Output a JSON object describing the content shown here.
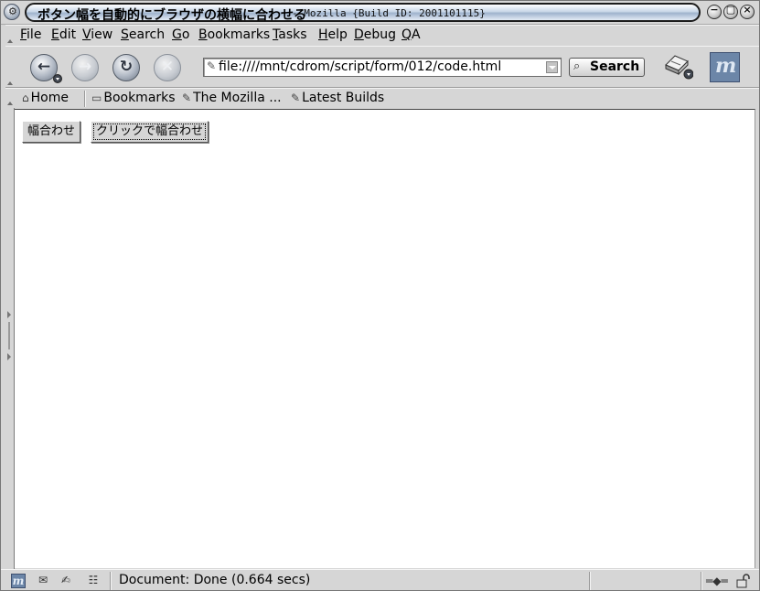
{
  "window": {
    "title": "ボタン幅を自動的にブラウザの横幅に合わせる",
    "app_title": "- Mozilla {Build ID: 2001101115}",
    "menu_glyph": "⚙",
    "minimize_glyph": "−",
    "maximize_glyph": "▢",
    "close_glyph": "×"
  },
  "menubar": {
    "items": [
      "File",
      "Edit",
      "View",
      "Search",
      "Go",
      "Bookmarks",
      "Tasks",
      "Help",
      "Debug",
      "QA"
    ]
  },
  "navbar": {
    "back_icon": "←",
    "forward_icon": "→",
    "reload_icon": "↻",
    "stop_icon": "✕",
    "url_icon": "✎",
    "url": "file:////mnt/cdrom/script/form/012/code.html",
    "search_icon": "⌕",
    "search_label": "Search",
    "throbber_letter": "m"
  },
  "personal_toolbar": {
    "home": "Home",
    "home_icon": "⌂",
    "bookmarks": "Bookmarks",
    "bookmarks_icon": "▭",
    "link1": "The Mozilla ...",
    "link2": "Latest Builds",
    "link_icon": "✎"
  },
  "page": {
    "button1": "幅合わせ",
    "button2": "クリックで幅合わせ"
  },
  "statusbar": {
    "text": "Document: Done (0.664 secs)",
    "moz_letter": "m",
    "mail_icon": "✉",
    "composer_icon": "✍",
    "addressbook_icon": "☷",
    "online_icon": "═◆═"
  }
}
